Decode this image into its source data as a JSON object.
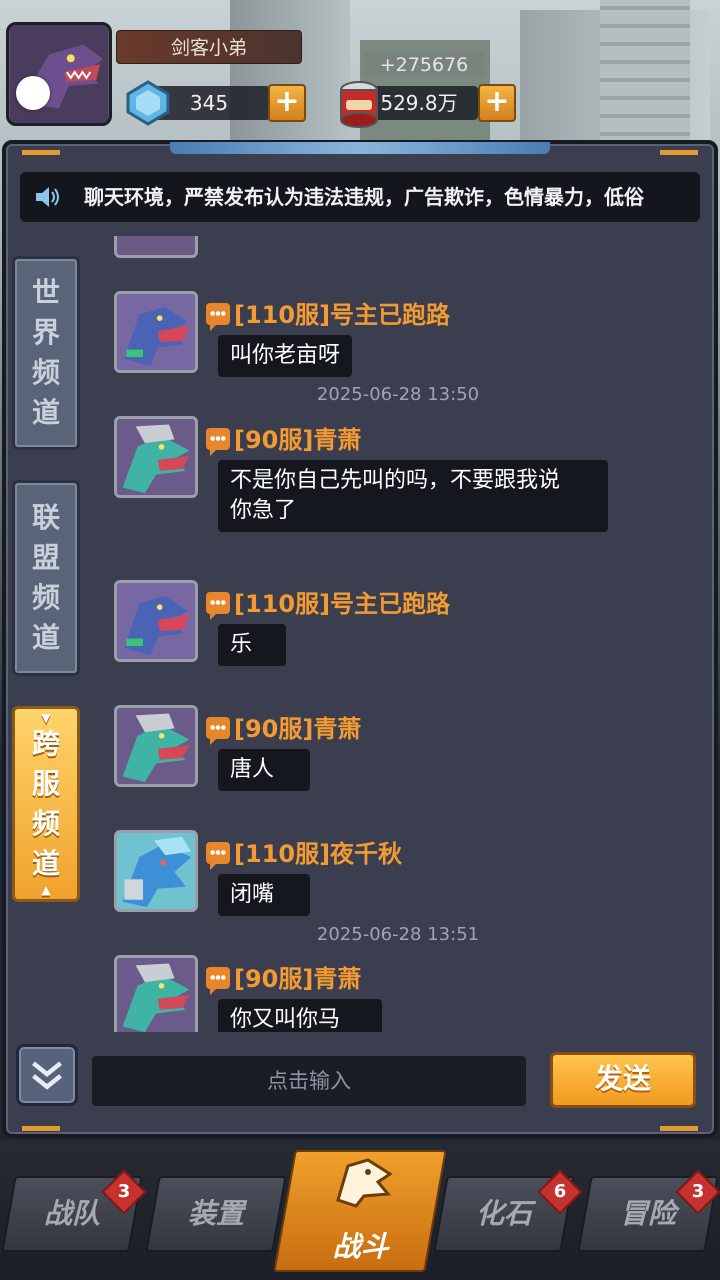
{
  "player": {
    "name": "剑客小弟",
    "gems": "345",
    "coins": "529.8万",
    "income": "+275676"
  },
  "notice": {
    "text": "聊天环境，严禁发布认为违法违规，广告欺诈，色情暴力，低俗"
  },
  "tabs": {
    "world": [
      "世",
      "界",
      "频",
      "道"
    ],
    "alliance": [
      "联",
      "盟",
      "频",
      "道"
    ],
    "cross": [
      "跨",
      "服",
      "频",
      "道"
    ]
  },
  "messages": [
    {
      "sender": "[110服]号主已跑路",
      "text": "叫你老亩呀",
      "avatar": "purple-dino-icon"
    },
    {
      "timestamp": "2025-06-28 13:50"
    },
    {
      "sender": "[90服]青萧",
      "text": "不是你自己先叫的吗，不要跟我说",
      "text2": "你急了",
      "avatar": "teal-dino-icon"
    },
    {
      "sender": "[110服]号主已跑路",
      "text": "乐",
      "avatar": "purple-dino-icon"
    },
    {
      "sender": "[90服]青萧",
      "text": "唐人",
      "avatar": "teal-dino-icon"
    },
    {
      "sender": "[110服]夜千秋",
      "text": "闭嘴",
      "avatar": "blue-dino-icon"
    },
    {
      "timestamp": "2025-06-28 13:51"
    },
    {
      "sender": "[90服]青萧",
      "text": "你又叫你马",
      "avatar": "teal-dino-icon"
    }
  ],
  "input": {
    "placeholder": "点击输入",
    "send_label": "发送"
  },
  "nav": {
    "team": "战队",
    "equip": "装置",
    "battle": "战斗",
    "fossil": "化石",
    "adventure": "冒险",
    "badges": {
      "team": "3",
      "fossil": "6",
      "adventure": "3"
    }
  },
  "colors": {
    "accent": "#f39a32",
    "panel": "#3a3e4e",
    "bubble": "#15171f",
    "active_tab": "#f0a22c"
  }
}
